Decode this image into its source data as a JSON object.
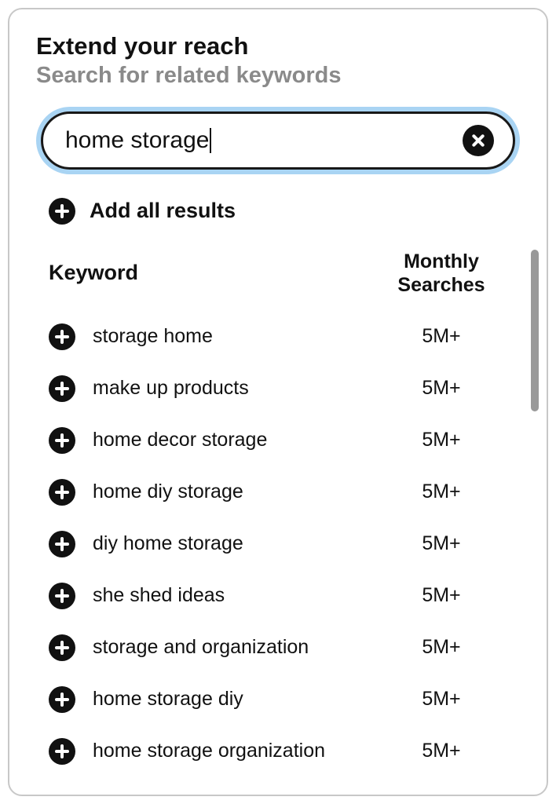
{
  "header": {
    "title": "Extend your reach",
    "subtitle": "Search for related keywords"
  },
  "search": {
    "value": "home storage"
  },
  "addAll": {
    "label": "Add all results"
  },
  "table": {
    "columns": {
      "keyword": "Keyword",
      "searches_line1": "Monthly",
      "searches_line2": "Searches"
    },
    "rows": [
      {
        "keyword": "storage home",
        "searches": "5M+"
      },
      {
        "keyword": "make up products",
        "searches": "5M+"
      },
      {
        "keyword": "home decor storage",
        "searches": "5M+"
      },
      {
        "keyword": "home diy storage",
        "searches": "5M+"
      },
      {
        "keyword": "diy home storage",
        "searches": "5M+"
      },
      {
        "keyword": "she shed ideas",
        "searches": "5M+"
      },
      {
        "keyword": "storage and organization",
        "searches": "5M+"
      },
      {
        "keyword": "home storage diy",
        "searches": "5M+"
      },
      {
        "keyword": "home storage organization",
        "searches": "5M+"
      }
    ]
  }
}
